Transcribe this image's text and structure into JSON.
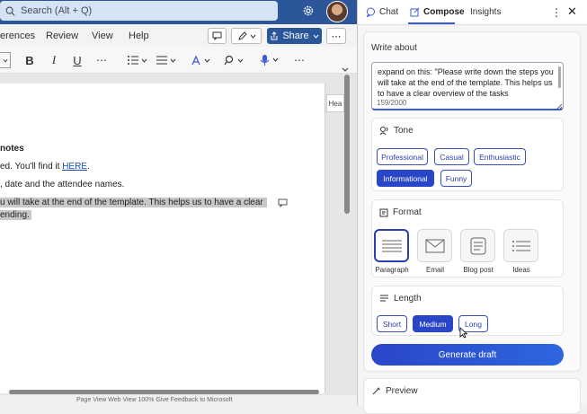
{
  "word": {
    "search_placeholder": "Search (Alt + Q)",
    "menu": [
      "erences",
      "Review",
      "View",
      "Help"
    ],
    "share_label": "Share",
    "side_tab": "Hea",
    "doc": {
      "line1": "notes",
      "line2_pre": "ed. You'll find it ",
      "line2_link": "HERE",
      "line2_post": ".",
      "line3": ", date and the attendee names.",
      "line4": "u will take at the end of the template. This helps us to have a clear",
      "line5": "ending."
    },
    "status": "Page View   Web View   100%   Give Feedback to Microsoft"
  },
  "panel": {
    "tabs": {
      "chat": "Chat",
      "compose": "Compose",
      "insights": "Insights"
    },
    "write_about": {
      "title": "Write about",
      "value": "expand on this: \"Please write down the steps you will take at the end of the template. This helps us to have a clear overview of the tasks",
      "counter": "159/2000"
    },
    "tone": {
      "title": "Tone",
      "options": [
        "Professional",
        "Casual",
        "Enthusiastic",
        "Informational",
        "Funny"
      ],
      "selected": "Informational"
    },
    "format": {
      "title": "Format",
      "options": [
        "Paragraph",
        "Email",
        "Blog post",
        "Ideas"
      ],
      "selected": "Paragraph"
    },
    "length": {
      "title": "Length",
      "options": [
        "Short",
        "Medium",
        "Long"
      ],
      "selected": "Medium"
    },
    "generate_label": "Generate draft",
    "preview_title": "Preview"
  },
  "colors": {
    "accent": "#2a46c8",
    "titlebar": "#2b579a"
  }
}
